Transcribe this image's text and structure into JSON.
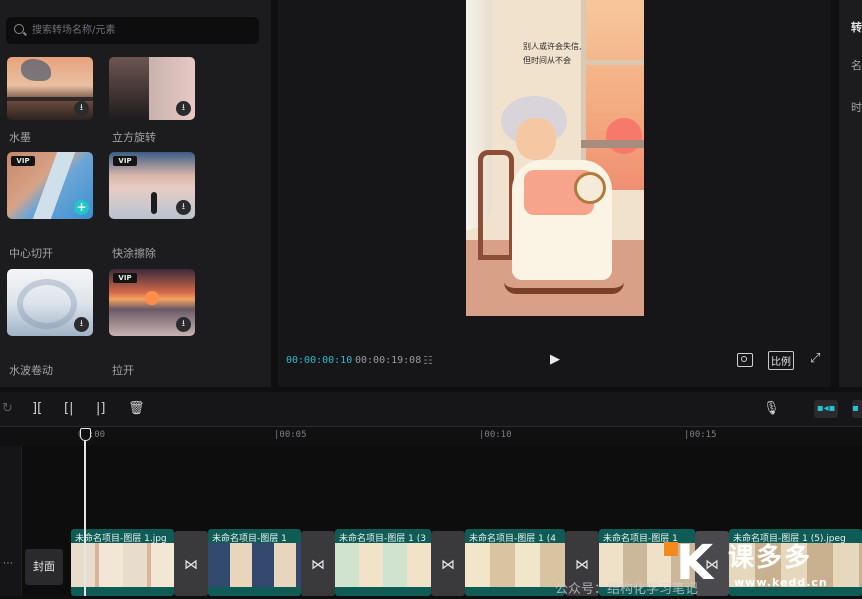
{
  "search": {
    "placeholder": "搜索转场名称/元素"
  },
  "transitions": [
    {
      "label": "水墨",
      "vip": false,
      "action": "download-icon"
    },
    {
      "label": "立方旋转",
      "vip": false,
      "action": "download-icon"
    },
    {
      "label": "中心切开",
      "vip": true,
      "action": "add-icon"
    },
    {
      "label": "快涂擦除",
      "vip": true,
      "action": "download-icon"
    },
    {
      "label": "水波卷动",
      "vip": false,
      "action": "download-icon"
    },
    {
      "label": "拉开",
      "vip": true,
      "action": "download-icon"
    }
  ],
  "vip_badge": "VIP",
  "preview": {
    "caption_line1": "别人或许会失信,",
    "caption_line2": "但时间从不会",
    "current_time": "00:00:00:10",
    "total_time": "00:00:19:08",
    "ratio_label": "比例"
  },
  "right_panel": {
    "items": [
      "转",
      "名",
      "时"
    ]
  },
  "ruler": {
    "ticks": [
      "00:00",
      "|00:05",
      "|00:10",
      "|00:15"
    ]
  },
  "timeline": {
    "cover_label": "封面",
    "clips": [
      "未命名项目-图层 1.jpg",
      "未命名项目-图层 1",
      "未命名项目-图层 1 (3",
      "未命名项目-图层 1 (4",
      "未命名项目-图层 1",
      "未命名项目-图层 1 (5).jpeg"
    ]
  },
  "watermark": {
    "text": "公众号：结构化学习笔记",
    "brand": "课多多",
    "url": "www.kedd.cn"
  }
}
